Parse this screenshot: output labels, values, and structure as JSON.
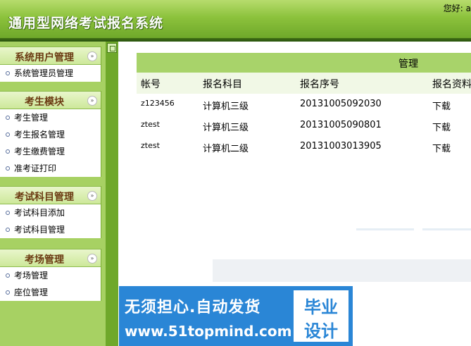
{
  "header": {
    "title": "通用型网络考试报名系统",
    "greeting": "您好: a"
  },
  "sidebar": {
    "groups": [
      {
        "title": "系统用户管理",
        "items": [
          "系统管理员管理"
        ]
      },
      {
        "title": "考生模块",
        "items": [
          "考生管理",
          "考生报名管理",
          "考生缴费管理",
          "准考证打印"
        ]
      },
      {
        "title": "考试科目管理",
        "items": [
          "考试科目添加",
          "考试科目管理"
        ]
      },
      {
        "title": "考场管理",
        "items": [
          "考场管理",
          "座位管理"
        ]
      }
    ],
    "toggle_glyph": "»"
  },
  "main": {
    "band_title": "管理",
    "columns": [
      "帐号",
      "报名科目",
      "报名序号",
      "报名资料"
    ],
    "rows": [
      {
        "account": "z123456",
        "subject": "计算机三级",
        "serial": "20131005092030",
        "doc": "下载"
      },
      {
        "account": "ztest",
        "subject": "计算机三级",
        "serial": "20131005090801",
        "doc": "下载"
      },
      {
        "account": "ztest",
        "subject": "计算机二级",
        "serial": "20131003013905",
        "doc": "下载"
      }
    ]
  },
  "ad": {
    "line1": "无须担心.自动发货",
    "line2": "www.51topmind.com",
    "box_line1": "毕业",
    "box_line2": "设计"
  },
  "colors": {
    "header": "#8cc23c",
    "sidebar": "#a7d163",
    "band": "#a8d36a",
    "ad": "#2a86d6"
  }
}
